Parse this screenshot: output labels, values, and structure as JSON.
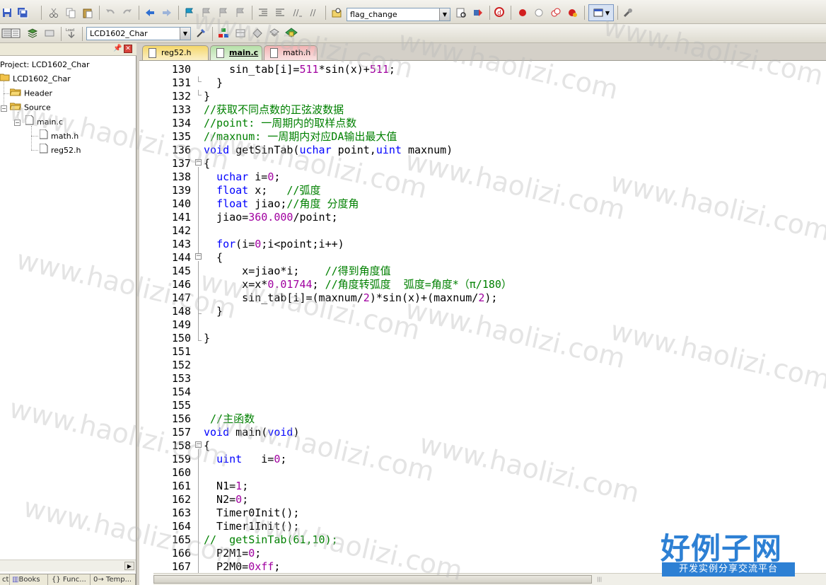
{
  "toolbar1": {
    "target_combo": "flag_change"
  },
  "toolbar2": {
    "target_combo": "LCD1602_Char",
    "load_label": "Load"
  },
  "project_panel": {
    "root": "Project: LCD1602_Char",
    "target": "LCD1602_Char",
    "groups": [
      {
        "label": "Header"
      },
      {
        "label": "Source"
      }
    ],
    "file": "main.c",
    "includes": [
      "math.h",
      "reg52.h"
    ],
    "tabs": [
      "ct",
      "Books",
      "{} Func...",
      "0→ Temp..."
    ]
  },
  "file_tabs": [
    {
      "label": "reg52.h",
      "color": "#f5d76a"
    },
    {
      "label": "main.c",
      "color": "#b6e0a8",
      "active": true
    },
    {
      "label": "math.h",
      "color": "#f2b3b3"
    }
  ],
  "editor": {
    "lines": [
      {
        "n": "130",
        "text": "    sin_tab[i]=511*sin(x)+511;"
      },
      {
        "n": "131",
        "text": "  }"
      },
      {
        "n": "132",
        "text": "}"
      },
      {
        "n": "133",
        "text": "//获取不同点数的正弦波数据"
      },
      {
        "n": "134",
        "text": "//point: 一周期内的取样点数"
      },
      {
        "n": "135",
        "text": "//maxnum: 一周期内对应DA输出最大值"
      },
      {
        "n": "136",
        "text": "void getSinTab(uchar point,uint maxnum)"
      },
      {
        "n": "137",
        "text": "{"
      },
      {
        "n": "138",
        "text": "  uchar i=0;"
      },
      {
        "n": "139",
        "text": "  float x;   //弧度"
      },
      {
        "n": "140",
        "text": "  float jiao;//角度 分度角"
      },
      {
        "n": "141",
        "text": "  jiao=360.000/point;"
      },
      {
        "n": "142",
        "text": ""
      },
      {
        "n": "143",
        "text": "  for(i=0;i<point;i++)"
      },
      {
        "n": "144",
        "text": "  {"
      },
      {
        "n": "145",
        "text": "      x=jiao*i;    //得到角度值"
      },
      {
        "n": "146",
        "text": "      x=x*0.01744; //角度转弧度  弧度=角度*（π/180）"
      },
      {
        "n": "147",
        "text": "      sin_tab[i]=(maxnum/2)*sin(x)+(maxnum/2);"
      },
      {
        "n": "148",
        "text": "  }"
      },
      {
        "n": "149",
        "text": ""
      },
      {
        "n": "150",
        "text": "}"
      },
      {
        "n": "151",
        "text": ""
      },
      {
        "n": "152",
        "text": ""
      },
      {
        "n": "153",
        "text": ""
      },
      {
        "n": "154",
        "text": ""
      },
      {
        "n": "155",
        "text": ""
      },
      {
        "n": "156",
        "text": " //主函数"
      },
      {
        "n": "157",
        "text": "void main(void)"
      },
      {
        "n": "158",
        "text": "{"
      },
      {
        "n": "159",
        "text": "  uint   i=0;"
      },
      {
        "n": "160",
        "text": ""
      },
      {
        "n": "161",
        "text": "  N1=1;"
      },
      {
        "n": "162",
        "text": "  N2=0;"
      },
      {
        "n": "163",
        "text": "  Timer0Init();"
      },
      {
        "n": "164",
        "text": "  Timer1Init();"
      },
      {
        "n": "165",
        "text": "//  getSinTab(61,10);"
      },
      {
        "n": "166",
        "text": "  P2M1=0;"
      },
      {
        "n": "167",
        "text": "  P2M0=0xff;"
      }
    ]
  },
  "watermark": {
    "site": "www.haolizi.com",
    "brand": "好例子网",
    "tagline": "开发实例分享交流平台"
  }
}
